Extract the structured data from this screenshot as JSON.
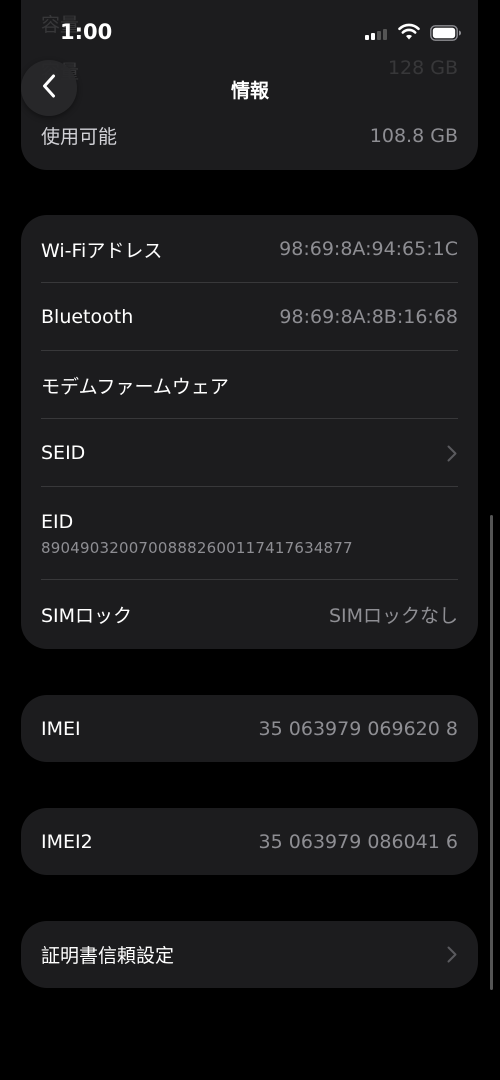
{
  "status_bar": {
    "time": "1:00"
  },
  "nav": {
    "title": "情報",
    "back_icon": "chevron-left-icon"
  },
  "storage": {
    "ghost_label_1": "容量",
    "ghost_label_2": "容量",
    "ghost_value_2": "128 GB",
    "usable_label": "使用可能",
    "usable_value": "108.8 GB"
  },
  "network": {
    "rows": [
      {
        "label": "Wi-Fiアドレス",
        "value": "98:69:8A:94:65:1C"
      },
      {
        "label": "Bluetooth",
        "value": "98:69:8A:8B:16:68"
      },
      {
        "label": "モデムファームウェア",
        "value": ""
      },
      {
        "label": "SEID",
        "value": ""
      },
      {
        "label": "EID",
        "value": "89049032007008882600117417634877"
      },
      {
        "label": "SIMロック",
        "value": "SIMロックなし"
      }
    ]
  },
  "imei": {
    "label": "IMEI",
    "value": "35 063979 069620 8"
  },
  "imei2": {
    "label": "IMEI2",
    "value": "35 063979 086041 6"
  },
  "cert": {
    "label": "証明書信頼設定"
  },
  "colors": {
    "background": "#000000",
    "cell": "#1c1c1e",
    "secondary_text": "#8e8e93"
  }
}
